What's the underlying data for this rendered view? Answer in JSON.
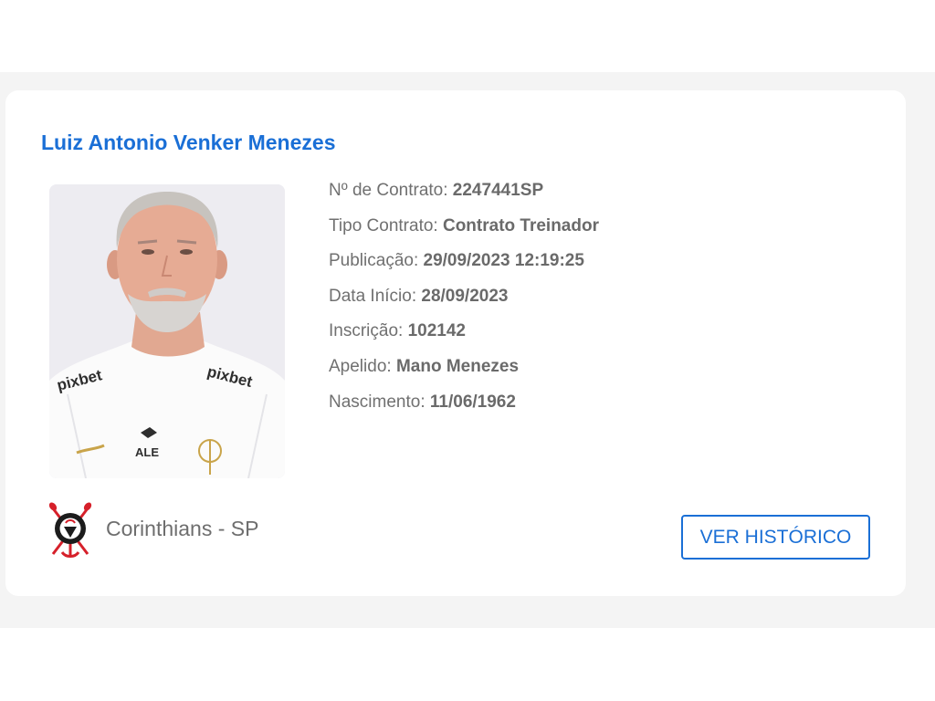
{
  "profile": {
    "name": "Luiz Antonio Venker Menezes",
    "photo_alt": "Luiz Antonio Venker Menezes",
    "fields": [
      {
        "label": "Nº de Contrato:",
        "value": "2247441SP"
      },
      {
        "label": "Tipo Contrato:",
        "value": "Contrato Treinador"
      },
      {
        "label": "Publicação:",
        "value": "29/09/2023 12:19:25"
      },
      {
        "label": "Data Início:",
        "value": "28/09/2023"
      },
      {
        "label": "Inscrição:",
        "value": "102142"
      },
      {
        "label": "Apelido:",
        "value": "Mano Menezes"
      },
      {
        "label": "Nascimento:",
        "value": "11/06/1962"
      }
    ]
  },
  "club": {
    "name": "Corinthians - SP",
    "logo_icon": "corinthians-crest-icon"
  },
  "actions": {
    "history_label": "VER HISTÓRICO"
  },
  "photo_shirt_logos": [
    "pixbet",
    "pixbet",
    "ALE"
  ],
  "colors": {
    "accent": "#1a6fd6",
    "label_text": "#707070",
    "background_band": "#f4f4f4",
    "card": "#ffffff",
    "crest_red": "#d6202a"
  }
}
